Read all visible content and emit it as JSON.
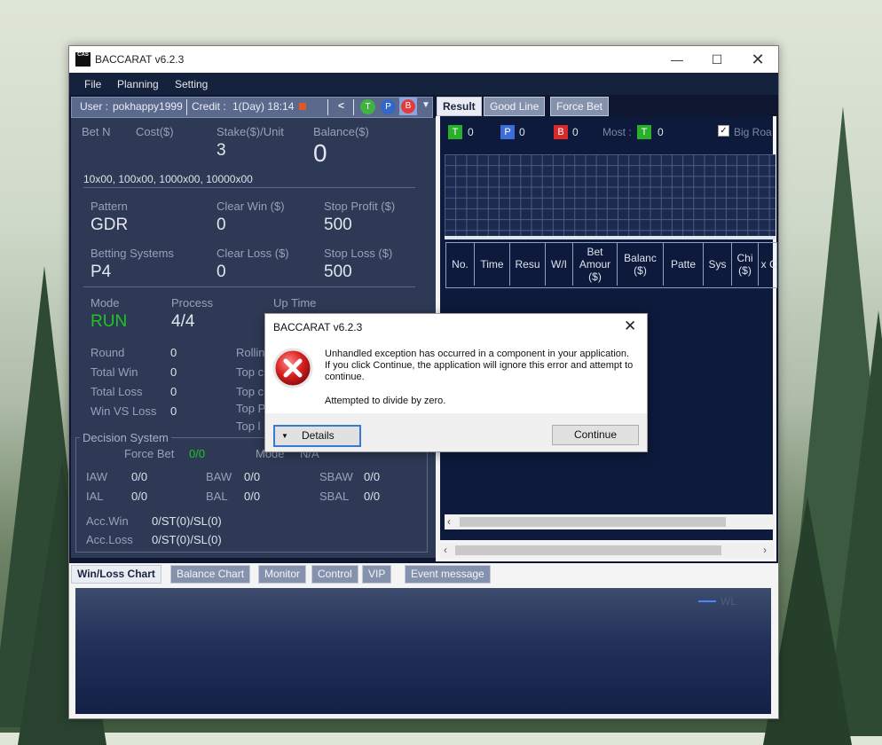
{
  "window": {
    "title": "BACCARAT v6.2.3",
    "icon_text": "CAS",
    "controls": [
      "minimize",
      "maximize",
      "close"
    ]
  },
  "menu": [
    "File",
    "Planning",
    "Setting"
  ],
  "userbar": {
    "user_label": "User :",
    "user": "pokhappy1999",
    "credit_label": "Credit :",
    "credit": "1(Day) 18:14",
    "back": "<",
    "t": "T",
    "p": "P",
    "b": "B"
  },
  "stats": {
    "bet_n_label": "Bet N",
    "cost_label": "Cost($)",
    "stake_label": "Stake($)/Unit",
    "stake_value": "3",
    "balance_label": "Balance($)",
    "balance_value": "0",
    "units": "10x00, 100x00, 1000x00, 10000x00",
    "pattern_label": "Pattern",
    "pattern_value": "GDR",
    "clear_win_label": "Clear Win ($)",
    "clear_win_value": "0",
    "stop_profit_label": "Stop Profit ($)",
    "stop_profit_value": "500",
    "betting_systems_label": "Betting Systems",
    "betting_systems_value": "P4",
    "clear_loss_label": "Clear Loss ($)",
    "clear_loss_value": "0",
    "stop_loss_label": "Stop Loss ($)",
    "stop_loss_value": "500",
    "mode_label": "Mode",
    "mode_value": "RUN",
    "process_label": "Process",
    "process_value": "4/4",
    "uptime_label": "Up Time",
    "round_label": "Round",
    "round_value": "0",
    "total_win_label": "Total Win",
    "total_win_value": "0",
    "total_loss_label": "Total Loss",
    "total_loss_value": "0",
    "win_vs_loss_label": "Win VS Loss",
    "win_vs_loss_value": "0",
    "rolling_label": "Rollin",
    "top_c1": "Top c",
    "top_c2": "Top c",
    "top_p": "Top P",
    "top_l": "Top l"
  },
  "decision": {
    "title": "Decision System",
    "force_bet_label": "Force Bet",
    "force_bet_value": "0/0",
    "mode_label": "Mode",
    "mode_value": "N/A",
    "iaw_label": "IAW",
    "iaw_value": "0/0",
    "baw_label": "BAW",
    "baw_value": "0/0",
    "sbaw_label": "SBAW",
    "sbaw_value": "0/0",
    "ial_label": "IAL",
    "ial_value": "0/0",
    "bal_label": "BAL",
    "bal_value": "0/0",
    "sbal_label": "SBAL",
    "sbal_value": "0/0",
    "acc_win_label": "Acc.Win",
    "acc_win_value": "0/ST(0)/SL(0)",
    "acc_loss_label": "Acc.Loss",
    "acc_loss_value": "0/ST(0)/SL(0)"
  },
  "right_tabs": [
    "Result",
    "Good Line",
    "Force Bet"
  ],
  "result": {
    "t_count": "0",
    "p_count": "0",
    "b_count": "0",
    "most_label": "Most :",
    "most_count": "0",
    "big_road_label": "Big Roa",
    "columns": [
      "No.",
      "Time",
      "Resu",
      "W/I",
      "Bet Amour ($)",
      "Balanc ($)",
      "Patte",
      "Sys",
      "Chi ($)",
      "x Ch"
    ]
  },
  "bottom_tabs": [
    "Win/Loss Chart",
    "Balance Chart",
    "Monitor",
    "Control",
    "VIP",
    "Event message"
  ],
  "chart": {
    "legend": "WL"
  },
  "dialog": {
    "title": "BACCARAT v6.2.3",
    "message1": "Unhandled exception has occurred in a component in your application. If you click Continue, the application will ignore this error and attempt to continue.",
    "message2": "Attempted to divide by zero.",
    "details_label": "Details",
    "continue_label": "Continue"
  },
  "colors": {
    "accent_green": "#21c321",
    "t_green": "#27b12b",
    "p_blue": "#3d6ed8",
    "b_red": "#d82a2a"
  }
}
